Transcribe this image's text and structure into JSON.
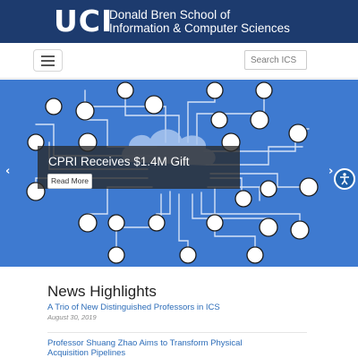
{
  "header": {
    "logo_mark": "UCI",
    "school_line1": "Donald Bren School of",
    "school_line2": "Information & Computer Sciences"
  },
  "navbar": {
    "menu_icon": "hamburger-icon",
    "search_placeholder": "Search ICS"
  },
  "carousel": {
    "slide_title": "CPRI Receives $1.4M Gift",
    "button_label": "Read More",
    "prev_arrow": "‹",
    "next_arrow": "›",
    "background_color": "#3e7ad0"
  },
  "accessibility_icon": "accessibility-icon",
  "news": {
    "heading": "News Highlights",
    "items": [
      {
        "title": "A Trio of New Distinguished Professors in ICS",
        "date": "August 30, 2019"
      },
      {
        "title": "Professor Shuang Zhao Aims to Transform Physical Acquisition Pipelines",
        "date": ""
      }
    ]
  },
  "colors": {
    "header_bg": "#1d3b6e",
    "link": "#2c6cb8"
  }
}
